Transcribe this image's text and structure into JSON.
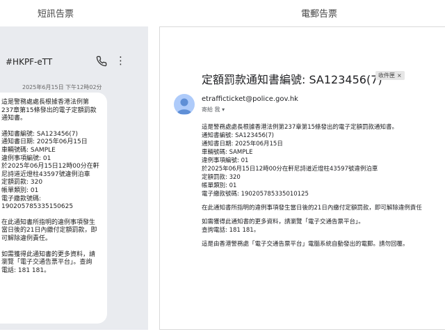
{
  "headers": {
    "sms": "短訊告票",
    "email": "電郵告票"
  },
  "sms": {
    "sender": "#HKPF-eTT",
    "timestamp": "2025年6月15日 下午12時02分",
    "icons": {
      "back": "back-arrow-icon",
      "call": "phone-icon",
      "more": "more-vert-icon"
    },
    "lines": [
      "這是警務處處長根據香港法例第",
      "237章第15條發出的電子定額罰款",
      "通知書。",
      "",
      "通知書編號: SA123456(7)",
      "通知書日期: 2025年06月15日",
      "車輛號碼: SAMPLE",
      "違例事項編號: 01",
      "於2025年06月15日12時00分在軒",
      "尼詩道近燈柱43597號違例泊車",
      "定額罰款: 320",
      "帳單類別: 01",
      "電子繳款號碼:",
      "190205785335150625",
      "",
      "在此通知書所指明的違例事項發生",
      "當日後的21日內繳付定額罰款，即",
      "可解除違例責任。",
      "",
      "如需獲得此通知書的更多資料，請",
      "瀏覽「電子交通告票平台」。查詢",
      "電話: 181 181。"
    ]
  },
  "email": {
    "subject": "定額罰款通知書編號: SA123456(7)",
    "label": "收件匣",
    "label_close": "×",
    "sender": "etrafficticket@police.gov.hk",
    "recipient": "寄給 我 ▾",
    "lines": [
      "這是警務處處長根據香港法例第237章第15條發出的電子定額罰款通知書。",
      "通知書編號: SA123456(7)",
      "通知書日期: 2025年06月15日",
      "車輛號碼: SAMPLE",
      "違例事項編號: 01",
      "於2025年06月15日12時00分在軒尼詩道近燈柱43597號違例泊車",
      "定額罰款: 320",
      "帳單類別: 01",
      "電子繳款號碼: 190205785335010125",
      "",
      "在此通知書所指明的違例事項發生當日後的21日內繳付定額罰款，即可解除違例責任",
      "",
      "如需獲得此通知書的更多資料，請瀏覽「電子交通告票平台」。",
      "查詢電話: 181 181。",
      "",
      "這是由香港警務處「電子交通告票平台」電腦系統自動發出的電郵。請勿回覆。"
    ]
  }
}
